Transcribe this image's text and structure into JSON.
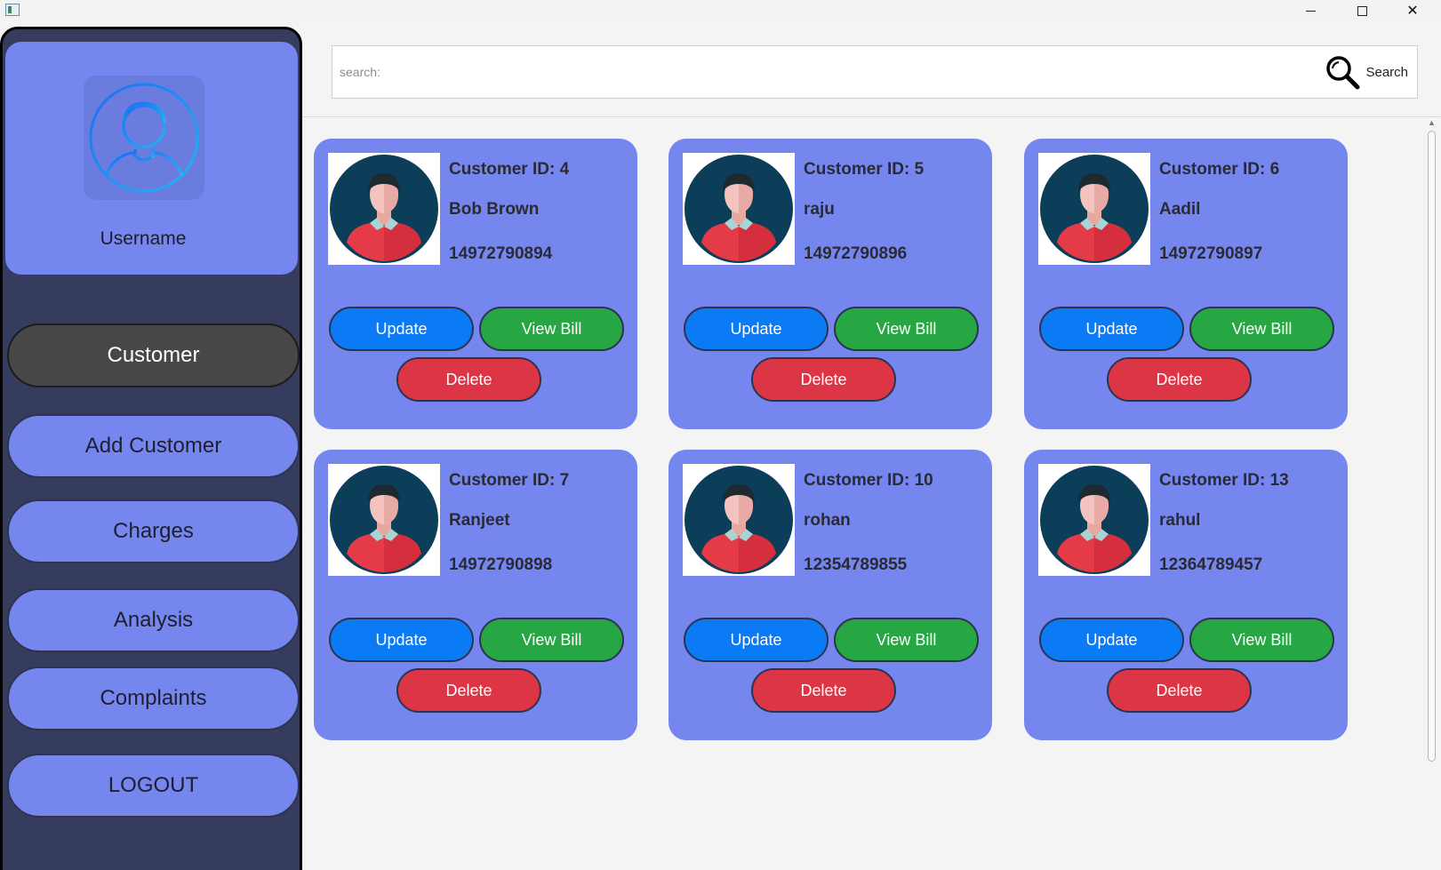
{
  "window": {
    "minimize": "—",
    "maximize": "□",
    "close": "✕"
  },
  "sidebar": {
    "username": "Username",
    "avatar_icon": "user-circle-icon",
    "nav": [
      {
        "label": "Customer",
        "active": true
      },
      {
        "label": "Add Customer",
        "active": false
      },
      {
        "label": "Charges",
        "active": false
      },
      {
        "label": "Analysis",
        "active": false
      },
      {
        "label": "Complaints",
        "active": false
      },
      {
        "label": "LOGOUT",
        "active": false
      }
    ]
  },
  "search": {
    "placeholder": "search:",
    "button_label": "Search",
    "icon": "magnifier-icon"
  },
  "card_actions": {
    "update": "Update",
    "view_bill": "View Bill",
    "delete": "Delete"
  },
  "customers": [
    {
      "id_text": "Customer ID: 4",
      "name": "Bob Brown",
      "phone": "14972790894"
    },
    {
      "id_text": "Customer ID: 5",
      "name": "raju",
      "phone": "14972790896"
    },
    {
      "id_text": "Customer ID: 6",
      "name": "Aadil",
      "phone": "14972790897"
    },
    {
      "id_text": "Customer ID: 7",
      "name": "Ranjeet",
      "phone": "14972790898"
    },
    {
      "id_text": "Customer ID: 10",
      "name": "rohan",
      "phone": "12354789855"
    },
    {
      "id_text": "Customer ID: 13",
      "name": "rahul",
      "phone": "12364789457"
    }
  ],
  "colors": {
    "sidebar_bg": "#363c5e",
    "accent": "#7587ee",
    "update": "#0a7bf5",
    "view_bill": "#27a744",
    "delete": "#dc3545",
    "active_nav": "#474747"
  }
}
